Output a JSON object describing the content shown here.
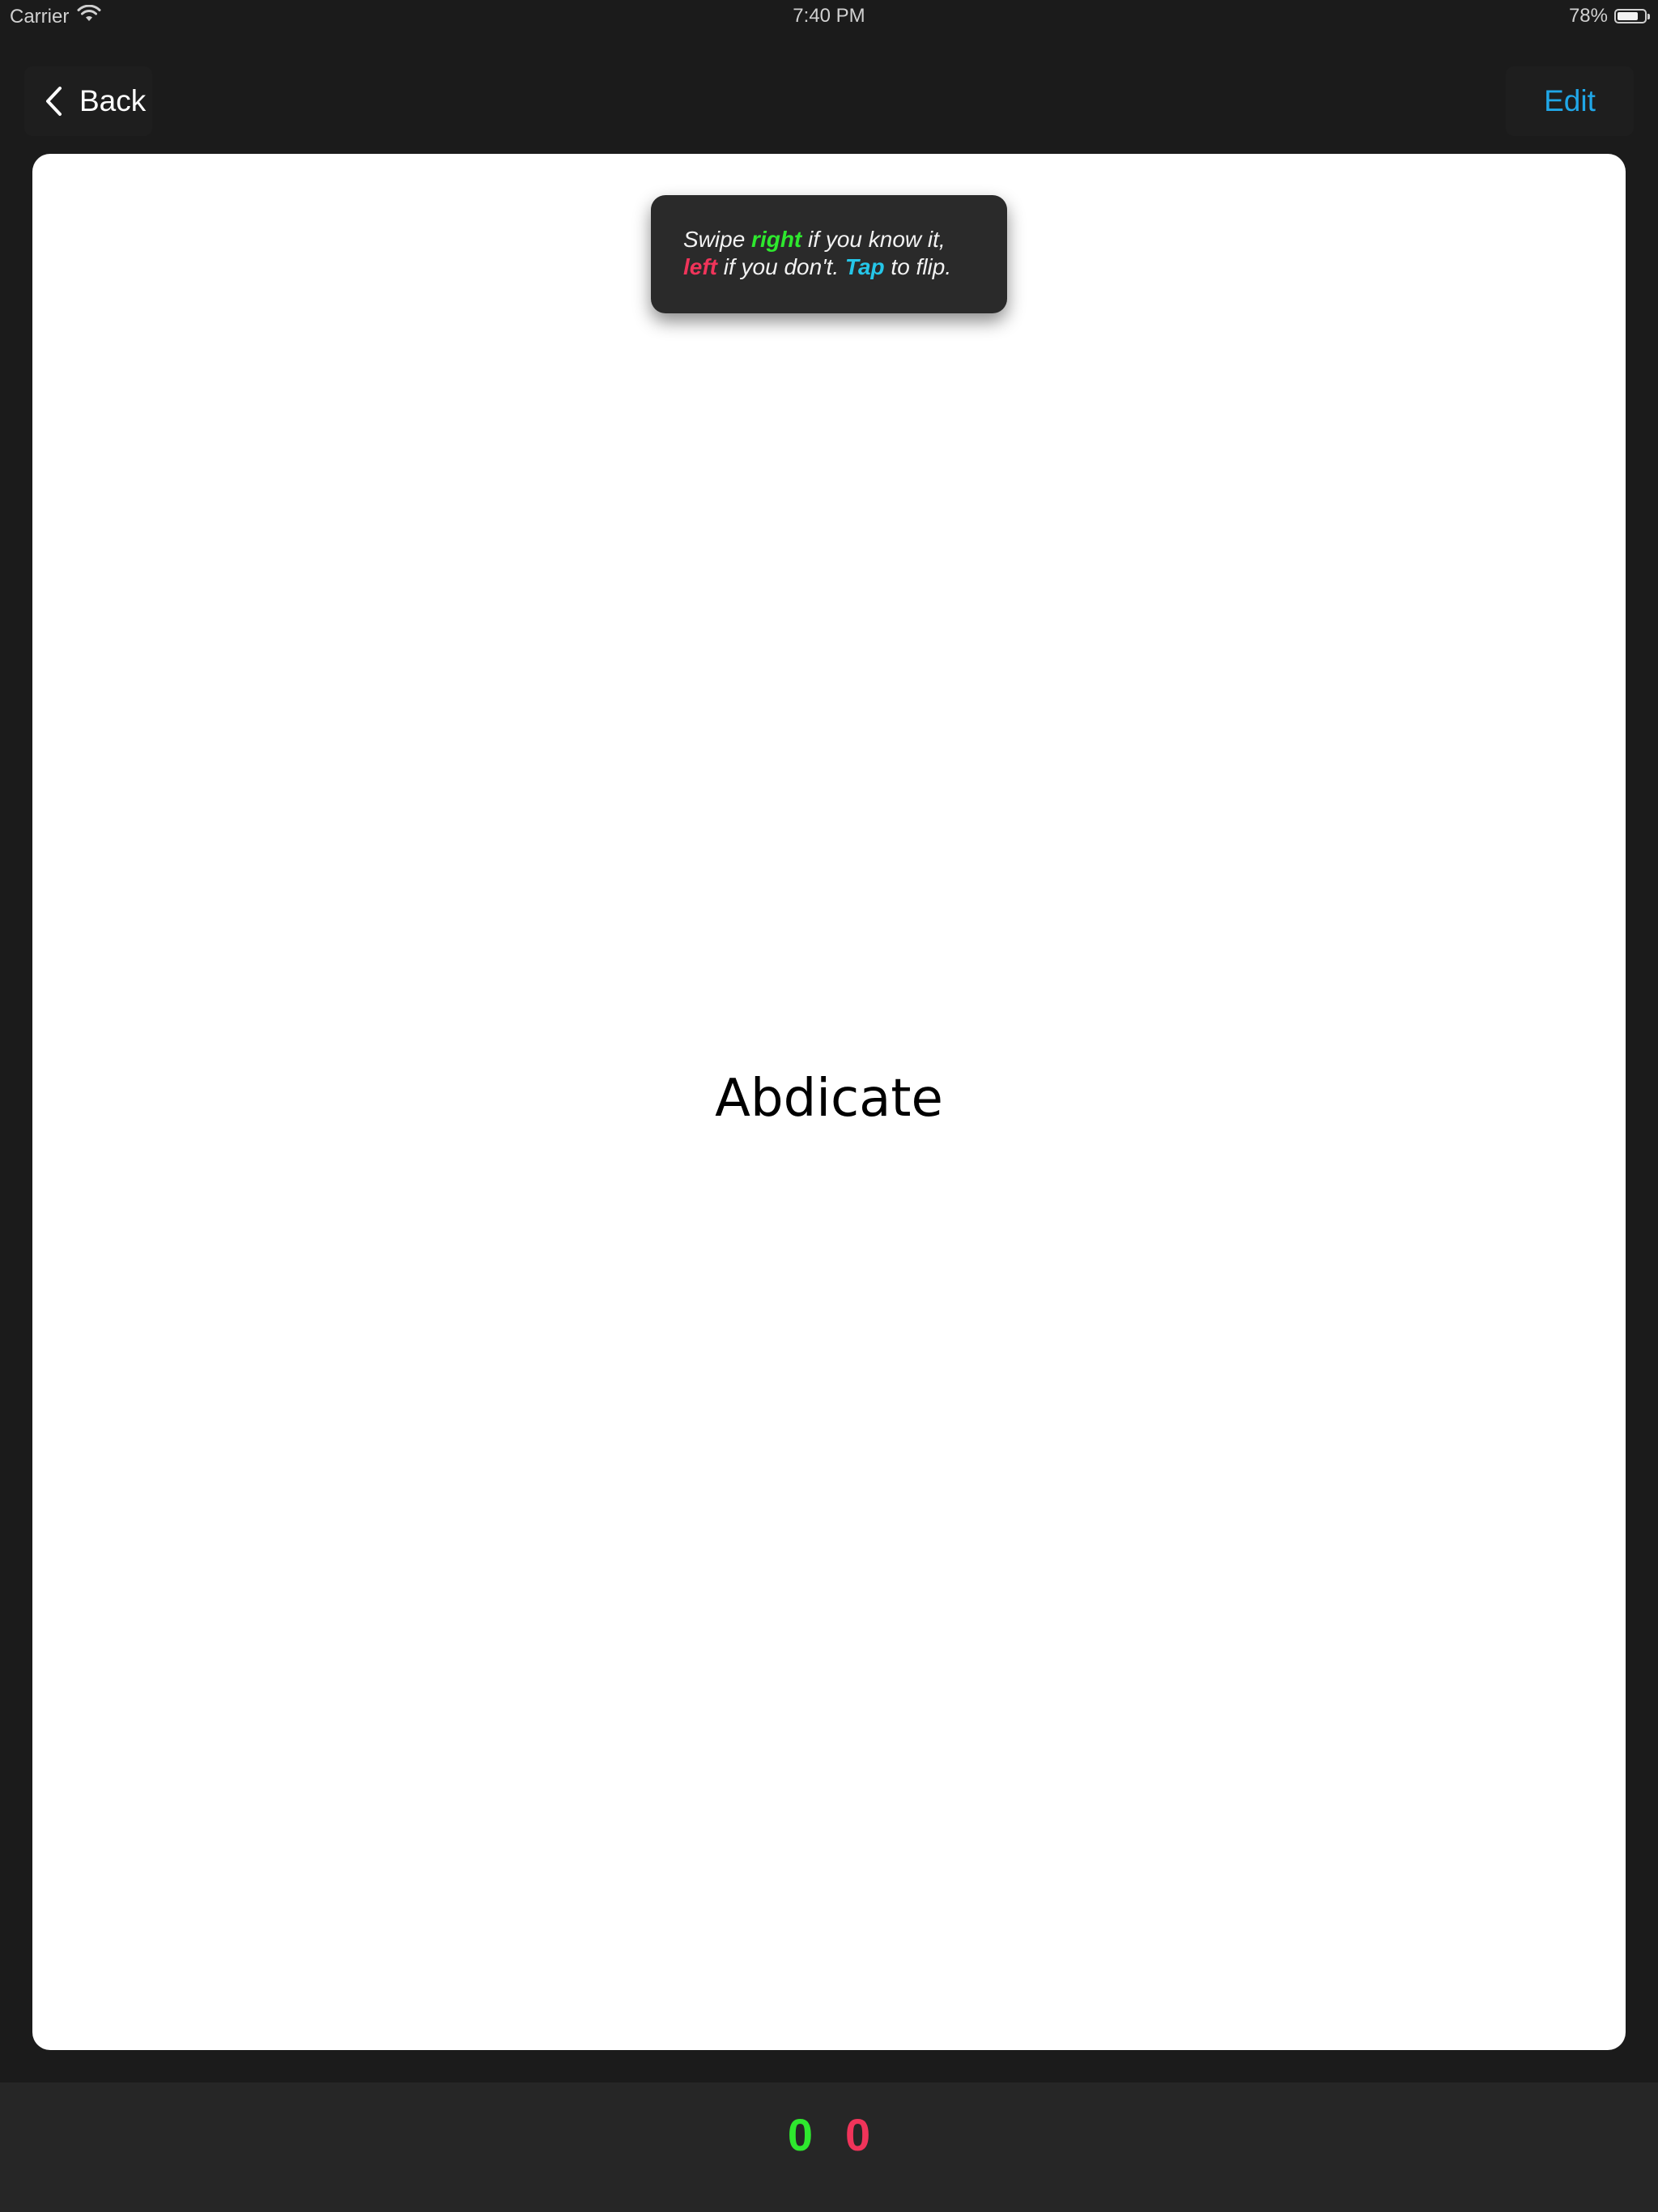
{
  "status_bar": {
    "carrier": "Carrier",
    "time": "7:40 PM",
    "battery_percent": "78%",
    "battery_level": 0.78
  },
  "nav": {
    "back_label": "Back",
    "edit_label": "Edit"
  },
  "hint": {
    "line1_prefix": "Swipe ",
    "line1_keyword": "right",
    "line1_suffix": " if you know it,",
    "line2_keyword1": "left",
    "line2_middle": " if you don't. ",
    "line2_keyword2": "Tap",
    "line2_suffix": " to flip."
  },
  "card": {
    "word": "Abdicate"
  },
  "scores": {
    "known": "0",
    "unknown": "0"
  },
  "colors": {
    "background": "#1b1b1b",
    "accent_blue": "#20a7e8",
    "known_green": "#2ee82e",
    "unknown_red": "#f0345a",
    "tap_cyan": "#25c6e8"
  },
  "icons": {
    "wifi": "wifi-icon",
    "battery": "battery-icon",
    "back": "chevron-left-icon"
  }
}
